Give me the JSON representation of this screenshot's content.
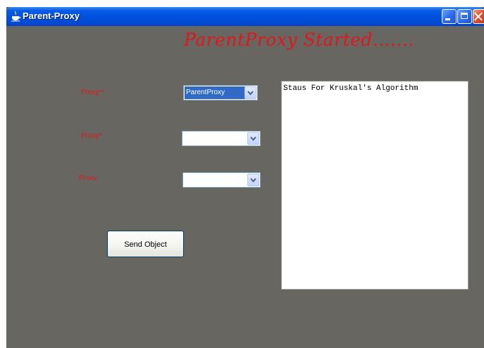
{
  "window": {
    "title": "Parent-Proxy",
    "colors": {
      "titlebar": "#0050de",
      "background": "#686660",
      "accent_red": "#e0161b"
    }
  },
  "heading": "ParentProxy Started.......",
  "proxies": [
    {
      "label": "Proxy**",
      "selected": "ParentProxy"
    },
    {
      "label": "Proxy*",
      "selected": ""
    },
    {
      "label": "Proxy",
      "selected": ""
    }
  ],
  "send_button": {
    "label": "Send Object"
  },
  "status_area": {
    "text": "Staus For Kruskal's Algorithm"
  }
}
